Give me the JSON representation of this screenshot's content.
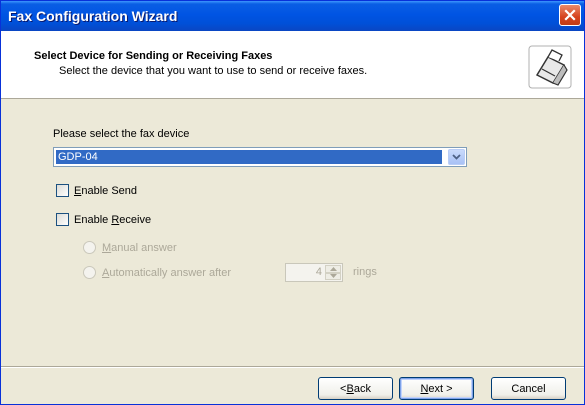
{
  "window": {
    "title": "Fax Configuration Wizard"
  },
  "header": {
    "title": "Select Device for Sending or Receiving Faxes",
    "subtitle": "Select the device that you want to use to send or receive faxes.",
    "icon": "fax-printer-icon"
  },
  "device": {
    "label": "Please select the fax device",
    "selected": "GDP-04"
  },
  "options": {
    "send": {
      "pre": "",
      "key": "E",
      "post": "nable Send",
      "checked": false
    },
    "receive": {
      "pre": "Enable ",
      "key": "R",
      "post": "eceive",
      "checked": false
    }
  },
  "answer": {
    "manual": {
      "pre": "",
      "key": "M",
      "post": "anual answer"
    },
    "auto": {
      "pre": "",
      "key": "A",
      "post": "utomatically answer after"
    },
    "rings_value": "4",
    "rings_label": "rings"
  },
  "buttons": {
    "back": {
      "pre": "< ",
      "key": "B",
      "post": "ack"
    },
    "next": {
      "pre": "",
      "key": "N",
      "post": "ext >"
    },
    "cancel": "Cancel"
  },
  "colors": {
    "titlebar": "#0054e3",
    "dialog_bg": "#ece9d8",
    "selection": "#316ac5",
    "disabled_text": "#aca899"
  }
}
